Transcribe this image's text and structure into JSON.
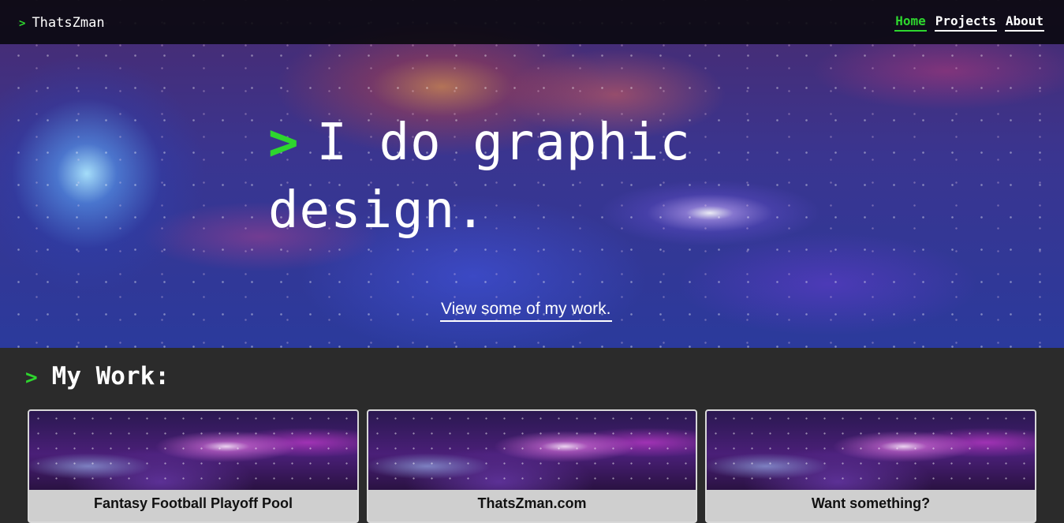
{
  "navbar": {
    "brand_prefix": ">",
    "brand": "ThatsZman",
    "links": [
      {
        "label": "Home",
        "active": true
      },
      {
        "label": "Projects",
        "active": false
      },
      {
        "label": "About",
        "active": false
      }
    ]
  },
  "hero": {
    "prefix": ">",
    "title": "I do graphic design.",
    "cta": "View some of my work."
  },
  "work": {
    "prefix": ">",
    "heading": "My Work:",
    "cards": [
      {
        "title": "Fantasy Football Playoff Pool"
      },
      {
        "title": "ThatsZman.com"
      },
      {
        "title": "Want something?"
      }
    ]
  },
  "colors": {
    "accent": "#2ed62e",
    "page_background": "#2b2b2b",
    "navbar_background": "#08080c",
    "card_background": "#cfcfcf"
  }
}
